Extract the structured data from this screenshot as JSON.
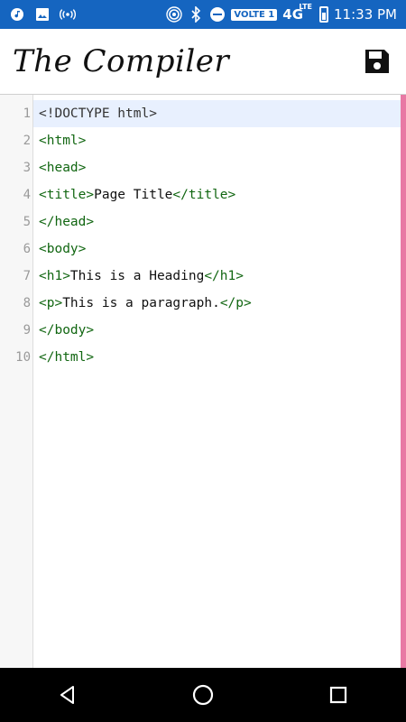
{
  "status_bar": {
    "time": "11:33 PM",
    "volte_label": "VOLTE 1",
    "network": "4G",
    "network_sup": "LTE"
  },
  "app": {
    "title": "The Compiler"
  },
  "editor": {
    "active_line": 1,
    "lines": [
      {
        "number": "1",
        "parts": [
          {
            "t": "doctype",
            "v": "<!DOCTYPE html>"
          }
        ]
      },
      {
        "number": "2",
        "parts": [
          {
            "t": "tag",
            "v": "<html>"
          }
        ]
      },
      {
        "number": "3",
        "parts": [
          {
            "t": "tag",
            "v": "<head>"
          }
        ]
      },
      {
        "number": "4",
        "parts": [
          {
            "t": "tag",
            "v": "<title>"
          },
          {
            "t": "text",
            "v": "Page Title"
          },
          {
            "t": "tag",
            "v": "</title>"
          }
        ]
      },
      {
        "number": "5",
        "parts": [
          {
            "t": "tag",
            "v": "</head>"
          }
        ]
      },
      {
        "number": "6",
        "parts": [
          {
            "t": "tag",
            "v": "<body>"
          }
        ]
      },
      {
        "number": "7",
        "parts": [
          {
            "t": "tag",
            "v": "<h1>"
          },
          {
            "t": "text",
            "v": "This is a Heading"
          },
          {
            "t": "tag",
            "v": "</h1>"
          }
        ]
      },
      {
        "number": "8",
        "parts": [
          {
            "t": "tag",
            "v": "<p>"
          },
          {
            "t": "text",
            "v": "This is a paragraph."
          },
          {
            "t": "tag",
            "v": "</p>"
          }
        ]
      },
      {
        "number": "9",
        "parts": [
          {
            "t": "tag",
            "v": "</body>"
          }
        ]
      },
      {
        "number": "10",
        "parts": [
          {
            "t": "tag",
            "v": "</html>"
          }
        ]
      }
    ]
  },
  "icons": {
    "music": "music-note-icon",
    "image": "image-icon",
    "radio": "broadcast-icon",
    "hotspot": "hotspot-icon",
    "bluetooth": "bluetooth-icon",
    "dnd": "do-not-disturb-icon",
    "save": "save-icon",
    "back": "back-icon",
    "home": "home-icon",
    "recents": "recents-icon"
  },
  "colors": {
    "status_bar": "#1565c0",
    "tag": "#116611",
    "active_line": "#e8f0fe",
    "scroll_edge": "#e879a4"
  }
}
